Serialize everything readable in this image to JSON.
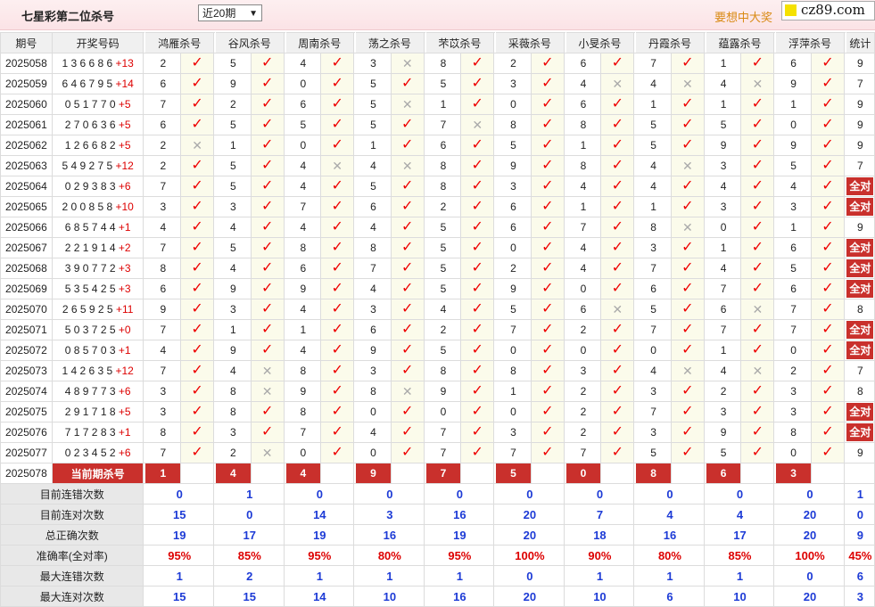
{
  "header": {
    "title": "七星彩第二位杀号",
    "period_select": "近20期",
    "slogan": "要想中大奖",
    "site": "cz89.com"
  },
  "columns": [
    "期号",
    "开奖号码",
    "鸿雁杀号",
    "谷风杀号",
    "周南杀号",
    "荡之杀号",
    "芣苡杀号",
    "采薇杀号",
    "小旻杀号",
    "丹霞杀号",
    "蕴露杀号",
    "浮萍杀号",
    "统计"
  ],
  "rows": [
    {
      "issue": "2025058",
      "digits": "1 3 6 6 8 6",
      "special": "+13",
      "kills": [
        [
          "2",
          "ok"
        ],
        [
          "5",
          "ok"
        ],
        [
          "4",
          "ok"
        ],
        [
          "3",
          "no"
        ],
        [
          "8",
          "ok"
        ],
        [
          "2",
          "ok"
        ],
        [
          "6",
          "ok"
        ],
        [
          "7",
          "ok"
        ],
        [
          "1",
          "ok"
        ],
        [
          "6",
          "ok"
        ]
      ],
      "stat": "9",
      "all": false
    },
    {
      "issue": "2025059",
      "digits": "6 4 6 7 9 5",
      "special": "+14",
      "kills": [
        [
          "6",
          "ok"
        ],
        [
          "9",
          "ok"
        ],
        [
          "0",
          "ok"
        ],
        [
          "5",
          "ok"
        ],
        [
          "5",
          "ok"
        ],
        [
          "3",
          "ok"
        ],
        [
          "4",
          "no"
        ],
        [
          "4",
          "no"
        ],
        [
          "4",
          "no"
        ],
        [
          "9",
          "ok"
        ]
      ],
      "stat": "7",
      "all": false
    },
    {
      "issue": "2025060",
      "digits": "0 5 1 7 7 0",
      "special": "+5",
      "kills": [
        [
          "7",
          "ok"
        ],
        [
          "2",
          "ok"
        ],
        [
          "6",
          "ok"
        ],
        [
          "5",
          "no"
        ],
        [
          "1",
          "ok"
        ],
        [
          "0",
          "ok"
        ],
        [
          "6",
          "ok"
        ],
        [
          "1",
          "ok"
        ],
        [
          "1",
          "ok"
        ],
        [
          "1",
          "ok"
        ]
      ],
      "stat": "9",
      "all": false
    },
    {
      "issue": "2025061",
      "digits": "2 7 0 6 3 6",
      "special": "+5",
      "kills": [
        [
          "6",
          "ok"
        ],
        [
          "5",
          "ok"
        ],
        [
          "5",
          "ok"
        ],
        [
          "5",
          "ok"
        ],
        [
          "7",
          "no"
        ],
        [
          "8",
          "ok"
        ],
        [
          "8",
          "ok"
        ],
        [
          "5",
          "ok"
        ],
        [
          "5",
          "ok"
        ],
        [
          "0",
          "ok"
        ]
      ],
      "stat": "9",
      "all": false
    },
    {
      "issue": "2025062",
      "digits": "1 2 6 6 8 2",
      "special": "+5",
      "kills": [
        [
          "2",
          "no"
        ],
        [
          "1",
          "ok"
        ],
        [
          "0",
          "ok"
        ],
        [
          "1",
          "ok"
        ],
        [
          "6",
          "ok"
        ],
        [
          "5",
          "ok"
        ],
        [
          "1",
          "ok"
        ],
        [
          "5",
          "ok"
        ],
        [
          "9",
          "ok"
        ],
        [
          "9",
          "ok"
        ]
      ],
      "stat": "9",
      "all": false
    },
    {
      "issue": "2025063",
      "digits": "5 4 9 2 7 5",
      "special": "+12",
      "kills": [
        [
          "2",
          "ok"
        ],
        [
          "5",
          "ok"
        ],
        [
          "4",
          "no"
        ],
        [
          "4",
          "no"
        ],
        [
          "8",
          "ok"
        ],
        [
          "9",
          "ok"
        ],
        [
          "8",
          "ok"
        ],
        [
          "4",
          "no"
        ],
        [
          "3",
          "ok"
        ],
        [
          "5",
          "ok"
        ]
      ],
      "stat": "7",
      "all": false
    },
    {
      "issue": "2025064",
      "digits": "0 2 9 3 8 3",
      "special": "+6",
      "kills": [
        [
          "7",
          "ok"
        ],
        [
          "5",
          "ok"
        ],
        [
          "4",
          "ok"
        ],
        [
          "5",
          "ok"
        ],
        [
          "8",
          "ok"
        ],
        [
          "3",
          "ok"
        ],
        [
          "4",
          "ok"
        ],
        [
          "4",
          "ok"
        ],
        [
          "4",
          "ok"
        ],
        [
          "4",
          "ok"
        ]
      ],
      "stat": "全对",
      "all": true
    },
    {
      "issue": "2025065",
      "digits": "2 0 0 8 5 8",
      "special": "+10",
      "kills": [
        [
          "3",
          "ok"
        ],
        [
          "3",
          "ok"
        ],
        [
          "7",
          "ok"
        ],
        [
          "6",
          "ok"
        ],
        [
          "2",
          "ok"
        ],
        [
          "6",
          "ok"
        ],
        [
          "1",
          "ok"
        ],
        [
          "1",
          "ok"
        ],
        [
          "3",
          "ok"
        ],
        [
          "3",
          "ok"
        ]
      ],
      "stat": "全对",
      "all": true
    },
    {
      "issue": "2025066",
      "digits": "6 8 5 7 4 4",
      "special": "+1",
      "kills": [
        [
          "4",
          "ok"
        ],
        [
          "4",
          "ok"
        ],
        [
          "4",
          "ok"
        ],
        [
          "4",
          "ok"
        ],
        [
          "5",
          "ok"
        ],
        [
          "6",
          "ok"
        ],
        [
          "7",
          "ok"
        ],
        [
          "8",
          "no"
        ],
        [
          "0",
          "ok"
        ],
        [
          "1",
          "ok"
        ]
      ],
      "stat": "9",
      "all": false
    },
    {
      "issue": "2025067",
      "digits": "2 2 1 9 1 4",
      "special": "+2",
      "kills": [
        [
          "7",
          "ok"
        ],
        [
          "5",
          "ok"
        ],
        [
          "8",
          "ok"
        ],
        [
          "8",
          "ok"
        ],
        [
          "5",
          "ok"
        ],
        [
          "0",
          "ok"
        ],
        [
          "4",
          "ok"
        ],
        [
          "3",
          "ok"
        ],
        [
          "1",
          "ok"
        ],
        [
          "6",
          "ok"
        ]
      ],
      "stat": "全对",
      "all": true
    },
    {
      "issue": "2025068",
      "digits": "3 9 0 7 7 2",
      "special": "+3",
      "kills": [
        [
          "8",
          "ok"
        ],
        [
          "4",
          "ok"
        ],
        [
          "6",
          "ok"
        ],
        [
          "7",
          "ok"
        ],
        [
          "5",
          "ok"
        ],
        [
          "2",
          "ok"
        ],
        [
          "4",
          "ok"
        ],
        [
          "7",
          "ok"
        ],
        [
          "4",
          "ok"
        ],
        [
          "5",
          "ok"
        ]
      ],
      "stat": "全对",
      "all": true
    },
    {
      "issue": "2025069",
      "digits": "5 3 5 4 2 5",
      "special": "+3",
      "kills": [
        [
          "6",
          "ok"
        ],
        [
          "9",
          "ok"
        ],
        [
          "9",
          "ok"
        ],
        [
          "4",
          "ok"
        ],
        [
          "5",
          "ok"
        ],
        [
          "9",
          "ok"
        ],
        [
          "0",
          "ok"
        ],
        [
          "6",
          "ok"
        ],
        [
          "7",
          "ok"
        ],
        [
          "6",
          "ok"
        ]
      ],
      "stat": "全对",
      "all": true
    },
    {
      "issue": "2025070",
      "digits": "2 6 5 9 2 5",
      "special": "+11",
      "kills": [
        [
          "9",
          "ok"
        ],
        [
          "3",
          "ok"
        ],
        [
          "4",
          "ok"
        ],
        [
          "3",
          "ok"
        ],
        [
          "4",
          "ok"
        ],
        [
          "5",
          "ok"
        ],
        [
          "6",
          "no"
        ],
        [
          "5",
          "ok"
        ],
        [
          "6",
          "no"
        ],
        [
          "7",
          "ok"
        ]
      ],
      "stat": "8",
      "all": false
    },
    {
      "issue": "2025071",
      "digits": "5 0 3 7 2 5",
      "special": "+0",
      "kills": [
        [
          "7",
          "ok"
        ],
        [
          "1",
          "ok"
        ],
        [
          "1",
          "ok"
        ],
        [
          "6",
          "ok"
        ],
        [
          "2",
          "ok"
        ],
        [
          "7",
          "ok"
        ],
        [
          "2",
          "ok"
        ],
        [
          "7",
          "ok"
        ],
        [
          "7",
          "ok"
        ],
        [
          "7",
          "ok"
        ]
      ],
      "stat": "全对",
      "all": true
    },
    {
      "issue": "2025072",
      "digits": "0 8 5 7 0 3",
      "special": "+1",
      "kills": [
        [
          "4",
          "ok"
        ],
        [
          "9",
          "ok"
        ],
        [
          "4",
          "ok"
        ],
        [
          "9",
          "ok"
        ],
        [
          "5",
          "ok"
        ],
        [
          "0",
          "ok"
        ],
        [
          "0",
          "ok"
        ],
        [
          "0",
          "ok"
        ],
        [
          "1",
          "ok"
        ],
        [
          "0",
          "ok"
        ]
      ],
      "stat": "全对",
      "all": true
    },
    {
      "issue": "2025073",
      "digits": "1 4 2 6 3 5",
      "special": "+12",
      "kills": [
        [
          "7",
          "ok"
        ],
        [
          "4",
          "no"
        ],
        [
          "8",
          "ok"
        ],
        [
          "3",
          "ok"
        ],
        [
          "8",
          "ok"
        ],
        [
          "8",
          "ok"
        ],
        [
          "3",
          "ok"
        ],
        [
          "4",
          "no"
        ],
        [
          "4",
          "no"
        ],
        [
          "2",
          "ok"
        ]
      ],
      "stat": "7",
      "all": false
    },
    {
      "issue": "2025074",
      "digits": "4 8 9 7 7 3",
      "special": "+6",
      "kills": [
        [
          "3",
          "ok"
        ],
        [
          "8",
          "no"
        ],
        [
          "9",
          "ok"
        ],
        [
          "8",
          "no"
        ],
        [
          "9",
          "ok"
        ],
        [
          "1",
          "ok"
        ],
        [
          "2",
          "ok"
        ],
        [
          "3",
          "ok"
        ],
        [
          "2",
          "ok"
        ],
        [
          "3",
          "ok"
        ]
      ],
      "stat": "8",
      "all": false
    },
    {
      "issue": "2025075",
      "digits": "2 9 1 7 1 8",
      "special": "+5",
      "kills": [
        [
          "3",
          "ok"
        ],
        [
          "8",
          "ok"
        ],
        [
          "8",
          "ok"
        ],
        [
          "0",
          "ok"
        ],
        [
          "0",
          "ok"
        ],
        [
          "0",
          "ok"
        ],
        [
          "2",
          "ok"
        ],
        [
          "7",
          "ok"
        ],
        [
          "3",
          "ok"
        ],
        [
          "3",
          "ok"
        ]
      ],
      "stat": "全对",
      "all": true
    },
    {
      "issue": "2025076",
      "digits": "7 1 7 2 8 3",
      "special": "+1",
      "kills": [
        [
          "8",
          "ok"
        ],
        [
          "3",
          "ok"
        ],
        [
          "7",
          "ok"
        ],
        [
          "4",
          "ok"
        ],
        [
          "7",
          "ok"
        ],
        [
          "3",
          "ok"
        ],
        [
          "2",
          "ok"
        ],
        [
          "3",
          "ok"
        ],
        [
          "9",
          "ok"
        ],
        [
          "8",
          "ok"
        ]
      ],
      "stat": "全对",
      "all": true
    },
    {
      "issue": "2025077",
      "digits": "0 2 3 4 5 2",
      "special": "+6",
      "kills": [
        [
          "7",
          "ok"
        ],
        [
          "2",
          "no"
        ],
        [
          "0",
          "ok"
        ],
        [
          "0",
          "ok"
        ],
        [
          "7",
          "ok"
        ],
        [
          "7",
          "ok"
        ],
        [
          "7",
          "ok"
        ],
        [
          "5",
          "ok"
        ],
        [
          "5",
          "ok"
        ],
        [
          "0",
          "ok"
        ]
      ],
      "stat": "9",
      "all": false
    }
  ],
  "current": {
    "issue": "2025078",
    "label": "当前期杀号",
    "kills": [
      "1",
      "4",
      "4",
      "9",
      "7",
      "5",
      "0",
      "8",
      "6",
      "3"
    ]
  },
  "stats": [
    {
      "label": "目前连错次数",
      "values": [
        "0",
        "1",
        "0",
        "0",
        "0",
        "0",
        "0",
        "0",
        "0",
        "0"
      ],
      "total": "1",
      "red": false
    },
    {
      "label": "目前连对次数",
      "values": [
        "15",
        "0",
        "14",
        "3",
        "16",
        "20",
        "7",
        "4",
        "4",
        "20"
      ],
      "total": "0",
      "red": false
    },
    {
      "label": "总正确次数",
      "values": [
        "19",
        "17",
        "19",
        "16",
        "19",
        "20",
        "18",
        "16",
        "17",
        "20"
      ],
      "total": "9",
      "red": false
    },
    {
      "label": "准确率(全对率)",
      "values": [
        "95%",
        "85%",
        "95%",
        "80%",
        "95%",
        "100%",
        "90%",
        "80%",
        "85%",
        "100%"
      ],
      "total": "45%",
      "red": true
    },
    {
      "label": "最大连错次数",
      "values": [
        "1",
        "2",
        "1",
        "1",
        "1",
        "0",
        "1",
        "1",
        "1",
        "0"
      ],
      "total": "6",
      "red": false
    },
    {
      "label": "最大连对次数",
      "values": [
        "15",
        "15",
        "14",
        "10",
        "16",
        "20",
        "10",
        "6",
        "10",
        "20"
      ],
      "total": "3",
      "red": false
    }
  ]
}
